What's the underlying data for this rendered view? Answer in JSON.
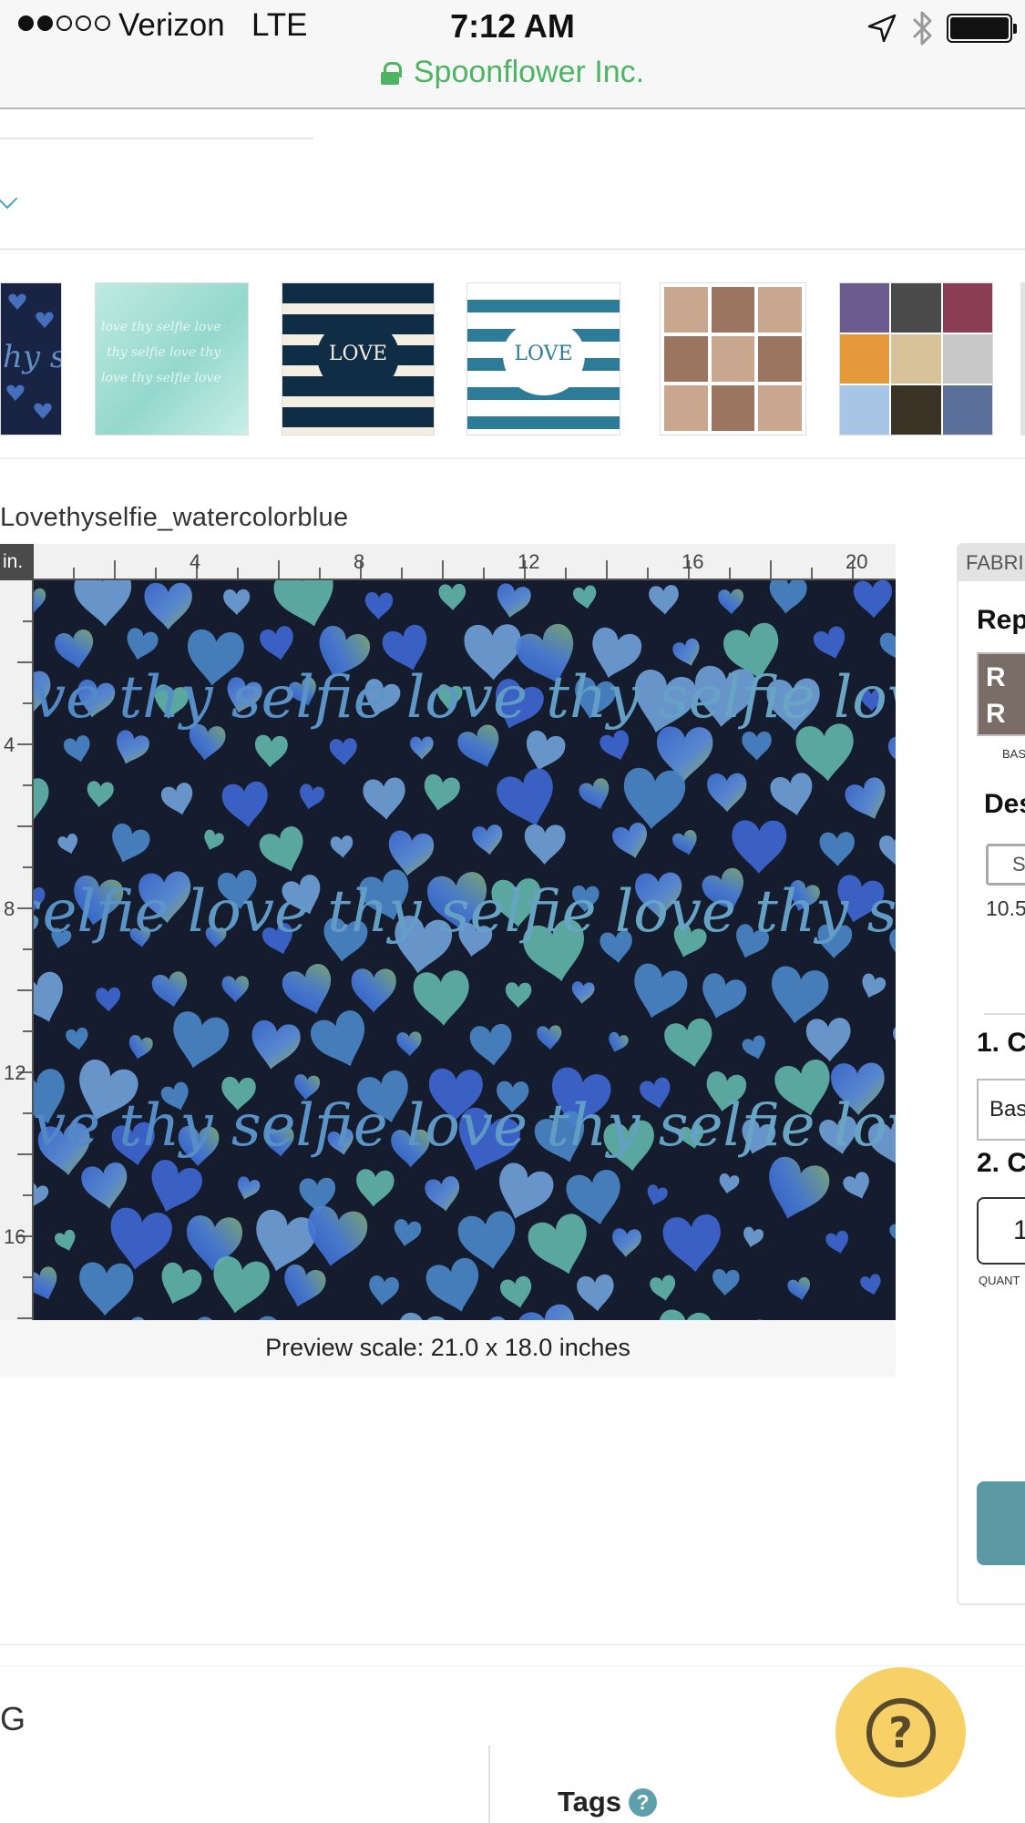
{
  "status_bar": {
    "carrier": "Verizon",
    "network": "LTE",
    "time": "7:12 AM",
    "site": "Spoonflower Inc.",
    "icons": [
      "location-arrow-icon",
      "bluetooth-icon",
      "battery-icon"
    ]
  },
  "thumbnails": [
    "lovethyselfie-hearts-navy",
    "lovethyselfie-watercolor-mint",
    "love-thy-selfie-stripes-navy",
    "love-thy-selfie-stripes-teal",
    "dog-photo-collage-sepia",
    "photo-collage-color"
  ],
  "design": {
    "title": "Lovethyselfie_watercolorblue",
    "units": "in.",
    "h_ruler_labels": [
      "4",
      "8",
      "12",
      "16",
      "20"
    ],
    "v_ruler_labels": [
      "4",
      "8",
      "12",
      "16"
    ],
    "pattern_text": "love thy selfie",
    "scale_caption": "Preview scale: 21.0 x 18.0 inches"
  },
  "panel": {
    "tab": "FABRI",
    "heading_repeat": "Rep",
    "swatch_text": "R R",
    "swatch_caption": "BAS",
    "heading_design": "Des",
    "size_button": "Si",
    "size_value": "10.5",
    "step1": "1. C",
    "fabric_select": "Bas",
    "step2": "2. C",
    "quantity": "1",
    "quantity_caption": "QUANT"
  },
  "bottom": {
    "section_heading": "G",
    "tags_heading": "Tags",
    "help_glyph": "?",
    "tags_help_glyph": "?"
  },
  "colors": {
    "accent_teal": "#5b9aa5",
    "secure_green": "#4cb462",
    "help_yellow": "#f7d165",
    "preview_bg": "#151c2e"
  }
}
